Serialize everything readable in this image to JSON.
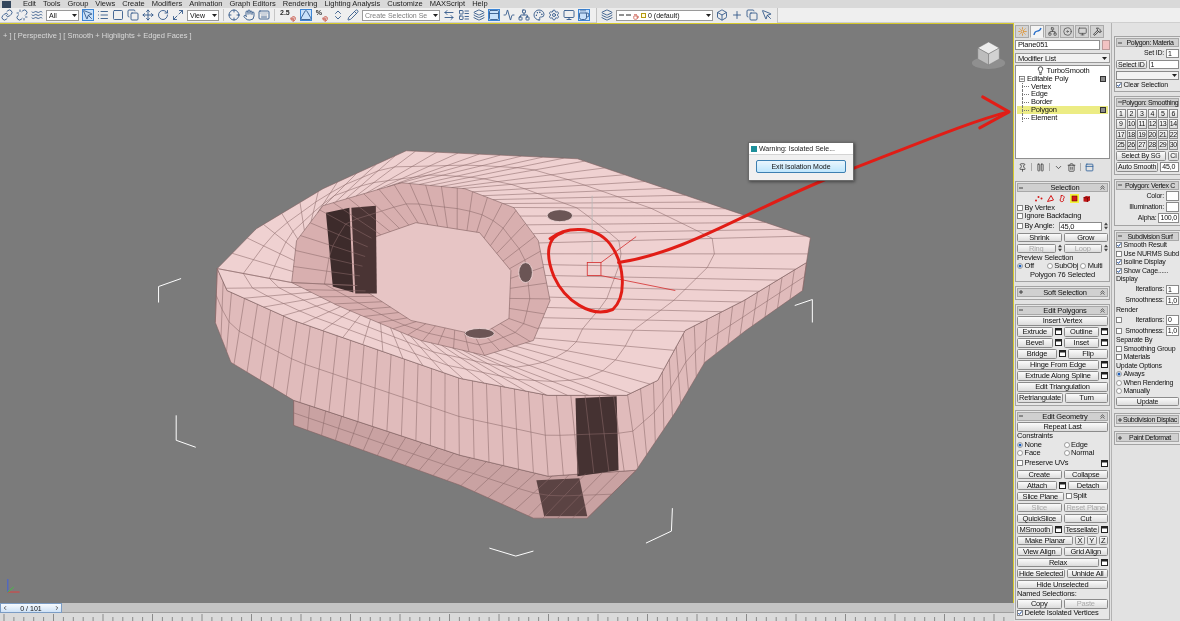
{
  "menu_bar": [
    "Edit",
    "Tools",
    "Group",
    "Views",
    "Create",
    "Modifiers",
    "Animation",
    "Graph Editors",
    "Rendering",
    "Lighting Analysis",
    "Customize",
    "MAXScript",
    "Help"
  ],
  "toolbar": [
    {
      "kind": "icon",
      "on": false
    },
    {
      "kind": "icon",
      "on": false
    },
    {
      "kind": "icon",
      "on": false
    },
    {
      "kind": "dropdown",
      "value": "All"
    },
    {
      "kind": "icon",
      "on": true
    },
    {
      "kind": "icon",
      "on": false
    },
    {
      "kind": "icon",
      "on": false
    },
    {
      "kind": "icon",
      "on": false
    },
    {
      "kind": "icon",
      "on": false
    },
    {
      "kind": "icon",
      "on": false
    },
    {
      "kind": "icon",
      "on": false
    },
    {
      "kind": "dropdown",
      "value": "View"
    },
    {
      "kind": "icon",
      "on": false
    },
    {
      "kind": "icon",
      "on": false
    },
    {
      "kind": "icon",
      "on": false
    },
    {
      "kind": "snap",
      "label": "2.5",
      "on": false
    },
    {
      "kind": "icon",
      "on": true
    },
    {
      "kind": "snap",
      "label": "%",
      "on": false
    },
    {
      "kind": "icon",
      "on": false
    },
    {
      "kind": "icon",
      "on": false
    },
    {
      "kind": "dropdown",
      "placeholder": "Create Selection Se"
    },
    {
      "kind": "icon",
      "on": false
    },
    {
      "kind": "icon",
      "on": false
    },
    {
      "kind": "icon",
      "on": false
    },
    {
      "kind": "icon",
      "on": true
    },
    {
      "kind": "icon",
      "on": false
    },
    {
      "kind": "icon",
      "on": false
    },
    {
      "kind": "icon",
      "on": false
    },
    {
      "kind": "icon",
      "on": false
    },
    {
      "kind": "icon",
      "on": false
    },
    {
      "kind": "icon",
      "on": true
    }
  ],
  "layer_toolbar": {
    "layer": "0 (default)"
  },
  "viewport": {
    "label": "+ ] [ Perspective ] [ Smooth + Highlights + Edged Faces ]"
  },
  "dialog": {
    "title": "Warning: Isolated Sele...",
    "button": "Exit Isolation Mode"
  },
  "time_slider": {
    "frame": "0 / 101",
    "level": 0
  },
  "command_panel": {
    "tabs": [
      {
        "selected": false
      },
      {
        "selected": true
      },
      {
        "selected": false
      },
      {
        "selected": false
      },
      {
        "selected": false
      },
      {
        "selected": false
      }
    ],
    "object_name": "Plane051",
    "modifier_list": "Modifier List",
    "stack": [
      {
        "kind": "modifier",
        "label": "TurboSmooth",
        "selected": false,
        "marked": false
      },
      {
        "kind": "object",
        "label": "Editable Poly",
        "selected": false,
        "marked": true,
        "expanded": true,
        "children": [
          {
            "label": "Vertex",
            "selected": false,
            "marked": false
          },
          {
            "label": "Edge",
            "selected": false,
            "marked": false
          },
          {
            "label": "Border",
            "selected": false,
            "marked": false
          },
          {
            "label": "Polygon",
            "selected": true,
            "marked": true
          },
          {
            "label": "Element",
            "selected": false,
            "marked": false
          }
        ]
      }
    ],
    "left_rollouts": [
      {
        "title": "Selection",
        "expanded": true,
        "rows": [
          [
            {
              "kind": "levels",
              "items": [
                {
                  "selected": false
                },
                {
                  "selected": false
                },
                {
                  "selected": false
                },
                {
                  "selected": true
                },
                {
                  "selected": false
                }
              ]
            }
          ],
          [
            {
              "kind": "checkbox",
              "label": "By Vertex",
              "checked": false
            }
          ],
          [
            {
              "kind": "checkbox",
              "label": "Ignore Backfacing",
              "checked": false
            }
          ],
          [
            {
              "kind": "checkbox",
              "label": "By Angle:",
              "checked": false
            },
            {
              "kind": "field",
              "value": "45,0"
            },
            {
              "kind": "spinner"
            }
          ],
          [
            {
              "kind": "button",
              "label": "Shrink",
              "disabled": false
            },
            {
              "kind": "button",
              "label": "Grow",
              "disabled": false
            }
          ],
          [
            {
              "kind": "button",
              "label": "Ring",
              "disabled": true
            },
            {
              "kind": "spinner"
            },
            {
              "kind": "button",
              "label": "Loop",
              "disabled": true
            },
            {
              "kind": "spinner"
            }
          ],
          [
            {
              "kind": "label",
              "text": "Preview Selection"
            }
          ],
          [
            {
              "kind": "radio",
              "label": "Off",
              "selected": true
            },
            {
              "kind": "radio",
              "label": "SubObj",
              "selected": false
            },
            {
              "kind": "radio",
              "label": "Multi",
              "selected": false
            }
          ],
          [
            {
              "kind": "status",
              "text": "Polygon 76 Selected"
            }
          ]
        ]
      },
      {
        "title": "Soft Selection",
        "expanded": false
      },
      {
        "title": "Edit Polygons",
        "expanded": true,
        "rows": [
          [
            {
              "kind": "button",
              "label": "Insert Vertex",
              "disabled": false
            }
          ],
          [
            {
              "kind": "button",
              "label": "Extrude",
              "disabled": false
            },
            {
              "kind": "settings"
            },
            {
              "kind": "button",
              "label": "Outline",
              "disabled": false
            },
            {
              "kind": "settings"
            }
          ],
          [
            {
              "kind": "button",
              "label": "Bevel",
              "disabled": false
            },
            {
              "kind": "settings"
            },
            {
              "kind": "button",
              "label": "Inset",
              "disabled": false
            },
            {
              "kind": "settings"
            }
          ],
          [
            {
              "kind": "button",
              "label": "Bridge",
              "disabled": false
            },
            {
              "kind": "settings"
            },
            {
              "kind": "button",
              "label": "Flip",
              "disabled": false
            }
          ],
          [
            {
              "kind": "button",
              "label": "Hinge From Edge",
              "disabled": false
            },
            {
              "kind": "settings"
            }
          ],
          [
            {
              "kind": "button",
              "label": "Extrude Along Spline",
              "disabled": false
            },
            {
              "kind": "settings"
            }
          ],
          [
            {
              "kind": "button",
              "label": "Edit Triangulation",
              "disabled": false
            }
          ],
          [
            {
              "kind": "button",
              "label": "Retriangulate",
              "disabled": false
            },
            {
              "kind": "button",
              "label": "Turn",
              "disabled": false
            }
          ]
        ]
      },
      {
        "title": "Edit Geometry",
        "expanded": true,
        "rows": [
          [
            {
              "kind": "button",
              "label": "Repeat Last",
              "disabled": false
            }
          ],
          [
            {
              "kind": "label",
              "text": "Constraints"
            }
          ],
          [
            {
              "kind": "radio",
              "label": "None",
              "selected": true
            },
            {
              "kind": "radio",
              "label": "Edge",
              "selected": false
            }
          ],
          [
            {
              "kind": "radio",
              "label": "Face",
              "selected": false
            },
            {
              "kind": "radio",
              "label": "Normal",
              "selected": false
            }
          ],
          [
            {
              "kind": "checkbox",
              "label": "Preserve UVs",
              "checked": false
            },
            {
              "kind": "settings"
            }
          ],
          [
            {
              "kind": "button",
              "label": "Create",
              "disabled": false
            },
            {
              "kind": "button",
              "label": "Collapse",
              "disabled": false
            }
          ],
          [
            {
              "kind": "button",
              "label": "Attach",
              "disabled": false
            },
            {
              "kind": "settings"
            },
            {
              "kind": "button",
              "label": "Detach",
              "disabled": false
            }
          ],
          [
            {
              "kind": "button",
              "label": "Slice Plane",
              "disabled": false
            },
            {
              "kind": "checkbox",
              "label": "Split",
              "checked": false
            }
          ],
          [
            {
              "kind": "button",
              "label": "Slice",
              "disabled": true
            },
            {
              "kind": "button",
              "label": "Reset Plane",
              "disabled": true
            }
          ],
          [
            {
              "kind": "button",
              "label": "QuickSlice",
              "disabled": false
            },
            {
              "kind": "button",
              "label": "Cut",
              "disabled": false
            }
          ],
          [
            {
              "kind": "button",
              "label": "MSmooth",
              "disabled": false
            },
            {
              "kind": "settings"
            },
            {
              "kind": "button",
              "label": "Tessellate",
              "disabled": false
            },
            {
              "kind": "settings"
            }
          ],
          [
            {
              "kind": "button",
              "label": "Make Planar",
              "disabled": false
            },
            {
              "kind": "button",
              "label": "X",
              "disabled": false
            },
            {
              "kind": "button",
              "label": "Y",
              "disabled": false
            },
            {
              "kind": "button",
              "label": "Z",
              "disabled": false
            }
          ],
          [
            {
              "kind": "button",
              "label": "View Align",
              "disabled": false
            },
            {
              "kind": "button",
              "label": "Grid Align",
              "disabled": false
            }
          ],
          [
            {
              "kind": "button",
              "label": "Relax",
              "disabled": false
            },
            {
              "kind": "settings"
            }
          ],
          [
            {
              "kind": "button",
              "label": "Hide Selected",
              "disabled": false
            },
            {
              "kind": "button",
              "label": "Unhide All",
              "disabled": false
            }
          ],
          [
            {
              "kind": "button",
              "label": "Hide Unselected",
              "disabled": false
            }
          ],
          [
            {
              "kind": "label",
              "text": "Named Selections:"
            }
          ],
          [
            {
              "kind": "button",
              "label": "Copy",
              "disabled": false
            },
            {
              "kind": "button",
              "label": "Paste",
              "disabled": true
            }
          ],
          [
            {
              "kind": "checkbox",
              "label": "Delete Isolated Vertices",
              "checked": true
            }
          ]
        ]
      }
    ],
    "right_rollouts": [
      {
        "title": "Polygon: Materia",
        "expanded": true,
        "rows": [
          [
            {
              "kind": "field",
              "label": "Set ID:",
              "value": "1"
            }
          ],
          [
            {
              "kind": "button",
              "label": "Select ID",
              "disabled": false
            },
            {
              "kind": "field",
              "value": "1"
            }
          ],
          [
            {
              "kind": "dropdown"
            }
          ],
          [
            {
              "kind": "checkbox",
              "label": "Clear Selection",
              "checked": true
            }
          ]
        ]
      },
      {
        "title": "Polygon: Smoothing",
        "expanded": true,
        "rows": [
          [
            {
              "kind": "grid",
              "items": [
                "1",
                "2",
                "3",
                "4",
                "5",
                "6",
                "9",
                "10",
                "11",
                "12",
                "13",
                "14",
                "17",
                "18",
                "19",
                "20",
                "21",
                "22",
                "25",
                "26",
                "27",
                "28",
                "29",
                "30"
              ]
            }
          ],
          [
            {
              "kind": "button",
              "label": "Select By SG",
              "disabled": false
            },
            {
              "kind": "button",
              "label": "Cl",
              "disabled": false
            }
          ],
          [
            {
              "kind": "button",
              "label": "Auto Smooth",
              "disabled": false
            },
            {
              "kind": "field",
              "value": "45,0"
            }
          ]
        ]
      },
      {
        "title": "Polygon: Vertex C",
        "expanded": true,
        "rows": [
          [
            {
              "kind": "field",
              "label": "Color:"
            }
          ],
          [
            {
              "kind": "field",
              "label": "Illumination:"
            }
          ],
          [
            {
              "kind": "field",
              "label": "Alpha:",
              "value": "100,0"
            }
          ]
        ]
      },
      {
        "title": "Subdivision Surf",
        "expanded": true,
        "rows": [
          [
            {
              "kind": "checkbox",
              "label": "Smooth Result",
              "checked": true
            }
          ],
          [
            {
              "kind": "checkbox",
              "label": "Use NURMS Subd",
              "checked": false
            }
          ],
          [
            {
              "kind": "checkbox",
              "label": "Isoline Display",
              "checked": true
            }
          ],
          [
            {
              "kind": "checkbox",
              "label": "Show Cage......",
              "checked": true
            }
          ],
          [
            {
              "kind": "label",
              "text": "Display"
            }
          ],
          [
            {
              "kind": "field",
              "label": "Iterations:",
              "value": "1"
            }
          ],
          [
            {
              "kind": "field",
              "label": "Smoothness:",
              "value": "1,0"
            }
          ],
          [
            {
              "kind": "label",
              "text": "Render"
            }
          ],
          [
            {
              "kind": "checkbox",
              "checked": false
            },
            {
              "kind": "field",
              "label": "Iterations:",
              "value": "0"
            }
          ],
          [
            {
              "kind": "checkbox",
              "checked": false
            },
            {
              "kind": "field",
              "label": "Smoothness:",
              "value": "1,0"
            }
          ],
          [
            {
              "kind": "label",
              "text": "Separate By"
            }
          ],
          [
            {
              "kind": "checkbox",
              "label": "Smoothing Group",
              "checked": false
            }
          ],
          [
            {
              "kind": "checkbox",
              "label": "Materials",
              "checked": false
            }
          ],
          [
            {
              "kind": "label",
              "text": "Update Options"
            }
          ],
          [
            {
              "kind": "radio",
              "label": "Always",
              "selected": true
            }
          ],
          [
            {
              "kind": "radio",
              "label": "When Rendering",
              "selected": false
            }
          ],
          [
            {
              "kind": "radio",
              "label": "Manually",
              "selected": false
            }
          ],
          [
            {
              "kind": "button",
              "label": "Update",
              "disabled": false
            }
          ]
        ]
      },
      {
        "title": "Subdivision Displac",
        "expanded": false
      },
      {
        "title": "Paint Deformat",
        "expanded": false
      }
    ]
  }
}
